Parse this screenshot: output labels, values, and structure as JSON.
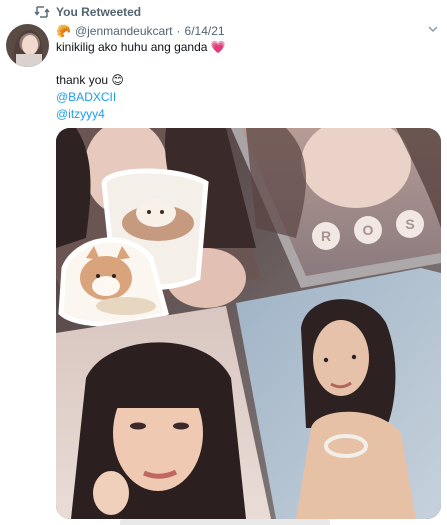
{
  "retweet": {
    "label": "You Retweeted",
    "icon": "retweet-icon"
  },
  "tweet": {
    "author_emoji": "🥐",
    "handle": "@jenmandeukcart",
    "separator": "·",
    "date": "6/14/21",
    "more_icon": "chevron-down-icon",
    "lines": {
      "line1": "kinikilig ako huhu ang ganda 💗",
      "line2": "thank you 😊"
    },
    "mentions": [
      "@BADXCII",
      "@itzyyy4"
    ],
    "photo_letters": [
      "R",
      "O",
      "S"
    ]
  },
  "colors": {
    "text": "#0f1419",
    "secondary": "#536471",
    "link": "#1d9bf0"
  }
}
